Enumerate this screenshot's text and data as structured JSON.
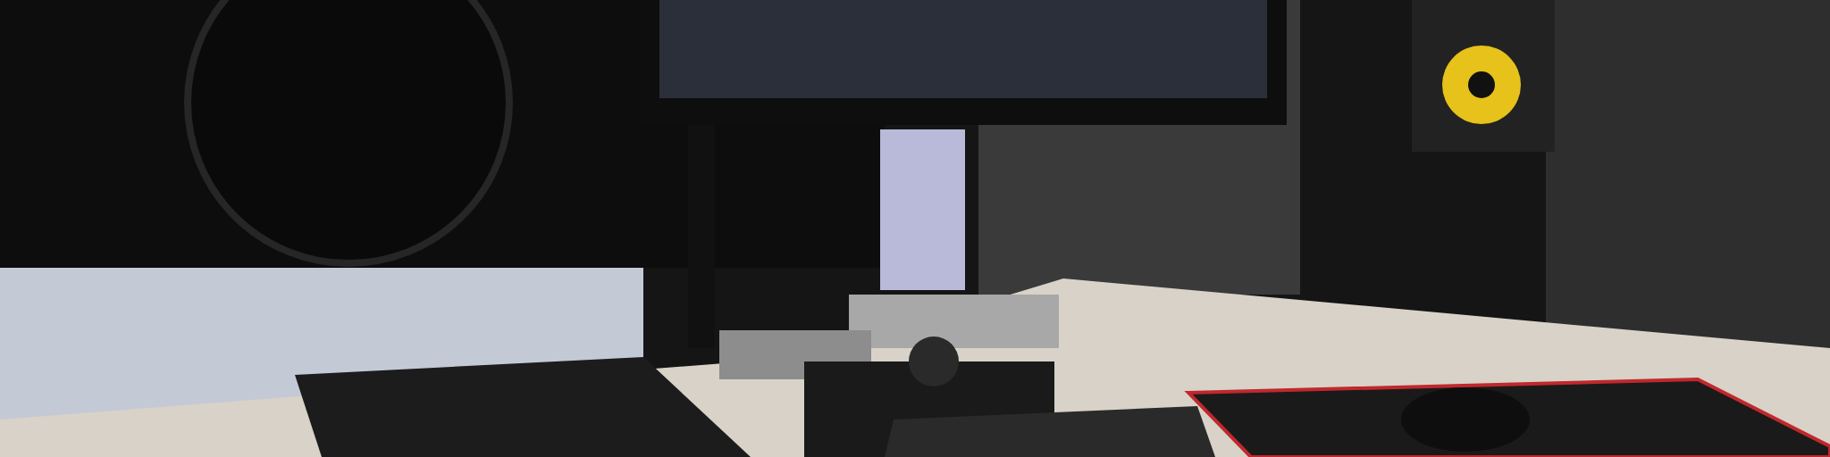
{
  "scene": {
    "photo": true
  }
}
